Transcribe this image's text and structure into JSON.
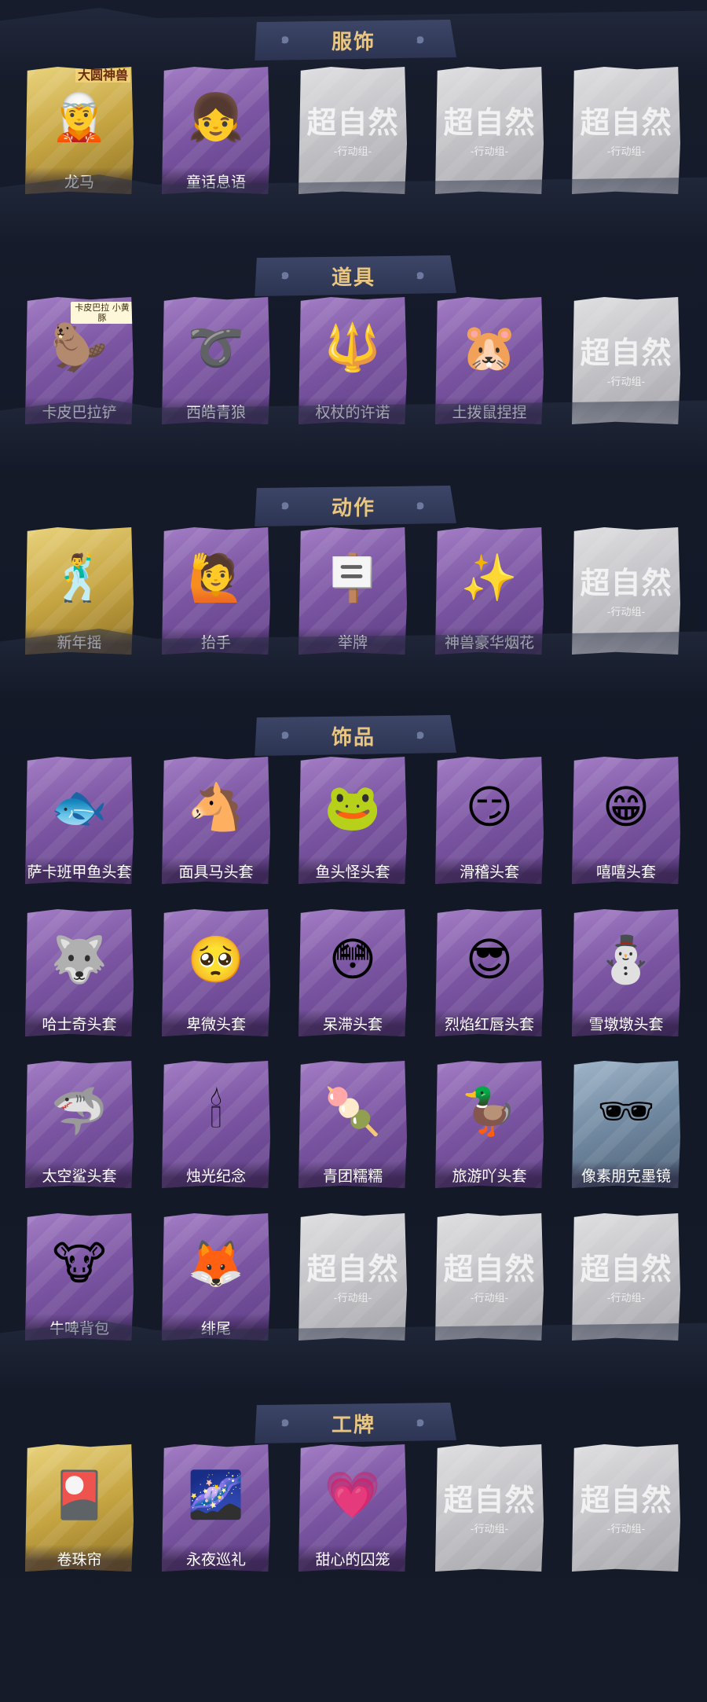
{
  "sections": [
    {
      "title": "服饰",
      "items": [
        {
          "label": "龙马",
          "style": "gold",
          "icon": "character-portrait-icon",
          "glyph": "🧝",
          "badge": "大圆神兽"
        },
        {
          "label": "童话息语",
          "style": "purple",
          "icon": "character-portrait-icon",
          "glyph": "👧"
        },
        {
          "label": "",
          "style": "empty",
          "icon": "placeholder-logo-icon"
        },
        {
          "label": "",
          "style": "empty",
          "icon": "placeholder-logo-icon"
        },
        {
          "label": "",
          "style": "empty",
          "icon": "placeholder-logo-icon"
        }
      ]
    },
    {
      "title": "道具",
      "items": [
        {
          "label": "卡皮巴拉铲",
          "style": "purple",
          "icon": "capybara-icon",
          "glyph": "🦫",
          "badge": "卡皮巴拉 小黄豚"
        },
        {
          "label": "西皓青狼",
          "style": "purple",
          "icon": "whip-staff-icon",
          "glyph": "➰"
        },
        {
          "label": "权杖的许诺",
          "style": "purple",
          "icon": "scepter-icon",
          "glyph": "🔱"
        },
        {
          "label": "土拨鼠捏捏",
          "style": "purple",
          "icon": "groundhog-icon",
          "glyph": "🐹"
        },
        {
          "label": "",
          "style": "empty",
          "icon": "placeholder-logo-icon"
        }
      ]
    },
    {
      "title": "动作",
      "items": [
        {
          "label": "新年摇",
          "style": "gold",
          "icon": "pose-figure-icon",
          "glyph": "🕺"
        },
        {
          "label": "抬手",
          "style": "purple",
          "icon": "pose-figure-icon",
          "glyph": "🙋"
        },
        {
          "label": "举牌",
          "style": "purple",
          "icon": "sign-holding-icon",
          "glyph": "🪧"
        },
        {
          "label": "神兽豪华烟花",
          "style": "purple",
          "icon": "fireworks-icon",
          "glyph": "✨"
        },
        {
          "label": "",
          "style": "empty",
          "icon": "placeholder-logo-icon"
        }
      ]
    },
    {
      "title": "饰品",
      "items": [
        {
          "label": "萨卡班甲鱼头套",
          "style": "purple",
          "icon": "fish-head-icon",
          "glyph": "🐟"
        },
        {
          "label": "面具马头套",
          "style": "purple",
          "icon": "horse-head-icon",
          "glyph": "🐴"
        },
        {
          "label": "鱼头怪头套",
          "style": "purple",
          "icon": "fish-monster-icon",
          "glyph": "🐸"
        },
        {
          "label": "滑稽头套",
          "style": "purple",
          "icon": "funny-face-icon",
          "glyph": "😏"
        },
        {
          "label": "嘻嘻头套",
          "style": "purple",
          "icon": "grin-face-icon",
          "glyph": "😁"
        },
        {
          "label": "哈士奇头套",
          "style": "purple",
          "icon": "husky-head-icon",
          "glyph": "🐺"
        },
        {
          "label": "卑微头套",
          "style": "purple",
          "icon": "humble-face-icon",
          "glyph": "🥺"
        },
        {
          "label": "呆滞头套",
          "style": "purple",
          "icon": "dazed-face-icon",
          "glyph": "😳"
        },
        {
          "label": "烈焰红唇头套",
          "style": "purple",
          "icon": "pikachu-lips-icon",
          "glyph": "😎"
        },
        {
          "label": "雪墩墩头套",
          "style": "purple",
          "icon": "snowman-head-icon",
          "glyph": "⛄"
        },
        {
          "label": "太空鲨头套",
          "style": "purple",
          "icon": "shark-head-icon",
          "glyph": "🦈"
        },
        {
          "label": "烛光纪念",
          "style": "purple",
          "icon": "candle-icon",
          "glyph": "🕯"
        },
        {
          "label": "青团糯糯",
          "style": "purple",
          "icon": "green-dumpling-icon",
          "glyph": "🍡"
        },
        {
          "label": "旅游吖头套",
          "style": "purple",
          "icon": "duck-hat-icon",
          "glyph": "🦆"
        },
        {
          "label": "像素朋克墨镜",
          "style": "blue",
          "icon": "pixel-sunglasses-icon",
          "glyph": "🕶"
        },
        {
          "label": "牛啤背包",
          "style": "purple",
          "icon": "cow-backpack-icon",
          "glyph": "🐮"
        },
        {
          "label": "绯尾",
          "style": "purple",
          "icon": "fox-tail-icon",
          "glyph": "🦊"
        },
        {
          "label": "",
          "style": "empty",
          "icon": "placeholder-logo-icon"
        },
        {
          "label": "",
          "style": "empty",
          "icon": "placeholder-logo-icon"
        },
        {
          "label": "",
          "style": "empty",
          "icon": "placeholder-logo-icon"
        }
      ]
    },
    {
      "title": "工牌",
      "items": [
        {
          "label": "卷珠帘",
          "style": "gold",
          "icon": "badge-card-icon",
          "glyph": "🎴"
        },
        {
          "label": "永夜巡礼",
          "style": "purple",
          "icon": "badge-card-icon",
          "glyph": "🌌"
        },
        {
          "label": "甜心的囚笼",
          "style": "purple",
          "icon": "badge-card-icon",
          "glyph": "💗"
        },
        {
          "label": "",
          "style": "empty",
          "icon": "placeholder-logo-icon"
        },
        {
          "label": "",
          "style": "empty",
          "icon": "placeholder-logo-icon"
        }
      ]
    }
  ],
  "placeholder": {
    "big": "超自然",
    "small": "-行动组-"
  }
}
